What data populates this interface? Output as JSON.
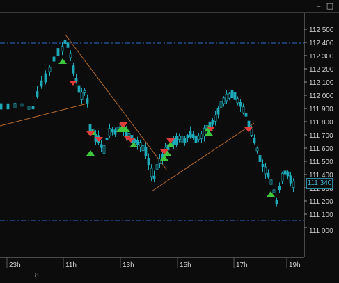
{
  "window": {
    "minimize_glyph": "–",
    "maximize_glyph": "□"
  },
  "price_axis": {
    "labels": [
      "112 500",
      "112 400",
      "112 300",
      "112 200",
      "112 100",
      "112 000",
      "111 900",
      "111 800",
      "111 700",
      "111 600",
      "111 500",
      "111 400",
      "111 300",
      "111 200",
      "111 100",
      "111 000"
    ],
    "current_price": "111 340"
  },
  "time_axis": {
    "labels": [
      "23h",
      "11h",
      "13h",
      "15h",
      "17h",
      "19h"
    ]
  },
  "status_bar": {
    "value": "8"
  },
  "colors": {
    "background": "#0c0c0c",
    "candle": "#1fa9b8",
    "buy_marker": "#3ec63e",
    "sell_marker": "#e23b3b",
    "trendline": "#b86a2a",
    "level_line": "#2b69c7",
    "axis_text": "#d2d2d2"
  },
  "chart_data": {
    "type": "candlestick",
    "price_levels_dashed": [
      112390,
      111045
    ],
    "trendlines": [
      {
        "from": [
          "",
          111800
        ],
        "to": [
          "11h",
          111930
        ]
      },
      {
        "from": [
          "~10h40",
          112450
        ],
        "to": [
          "~14h",
          111510
        ]
      },
      {
        "from": [
          "~13h50",
          111330
        ],
        "to": [
          "~17h10",
          111790
        ]
      }
    ],
    "markers": {
      "buy_count": 13,
      "sell_count": 11
    }
  }
}
